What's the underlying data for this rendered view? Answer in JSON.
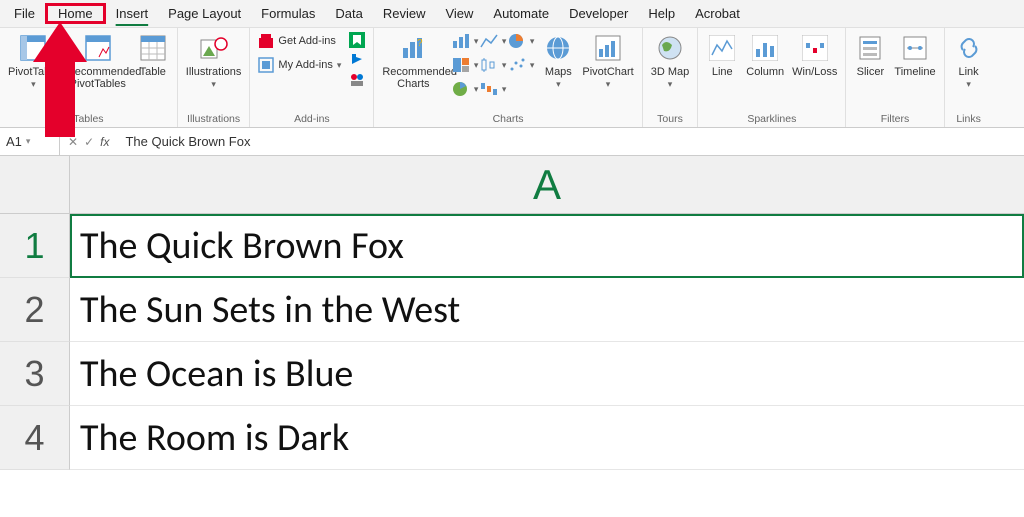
{
  "menu": {
    "file": "File",
    "home": "Home",
    "insert": "Insert",
    "page_layout": "Page Layout",
    "formulas": "Formulas",
    "data": "Data",
    "review": "Review",
    "view": "View",
    "automate": "Automate",
    "developer": "Developer",
    "help": "Help",
    "acrobat": "Acrobat"
  },
  "ribbon": {
    "tables": {
      "pivot": "PivotTable",
      "recommended": "Recommended PivotTables",
      "table": "Table",
      "group": "Tables"
    },
    "illustrations": {
      "label": "Illustrations",
      "group": "Illustrations"
    },
    "addins": {
      "get": "Get Add-ins",
      "my": "My Add-ins",
      "group": "Add-ins"
    },
    "charts": {
      "recommended": "Recommended Charts",
      "maps": "Maps",
      "pivotchart": "PivotChart",
      "group": "Charts"
    },
    "tours": {
      "map3d": "3D Map",
      "group": "Tours"
    },
    "spark": {
      "line": "Line",
      "column": "Column",
      "winloss": "Win/Loss",
      "group": "Sparklines"
    },
    "filters": {
      "slicer": "Slicer",
      "timeline": "Timeline",
      "group": "Filters"
    },
    "links": {
      "link": "Link",
      "group": "Links"
    }
  },
  "formula_bar": {
    "cellref": "A1",
    "value": "The Quick Brown Fox"
  },
  "sheet": {
    "col": "A",
    "rows": [
      "1",
      "2",
      "3",
      "4"
    ],
    "cells": [
      "The Quick Brown Fox",
      "The Sun Sets in the West",
      "The Ocean is Blue",
      "The Room is Dark"
    ]
  }
}
